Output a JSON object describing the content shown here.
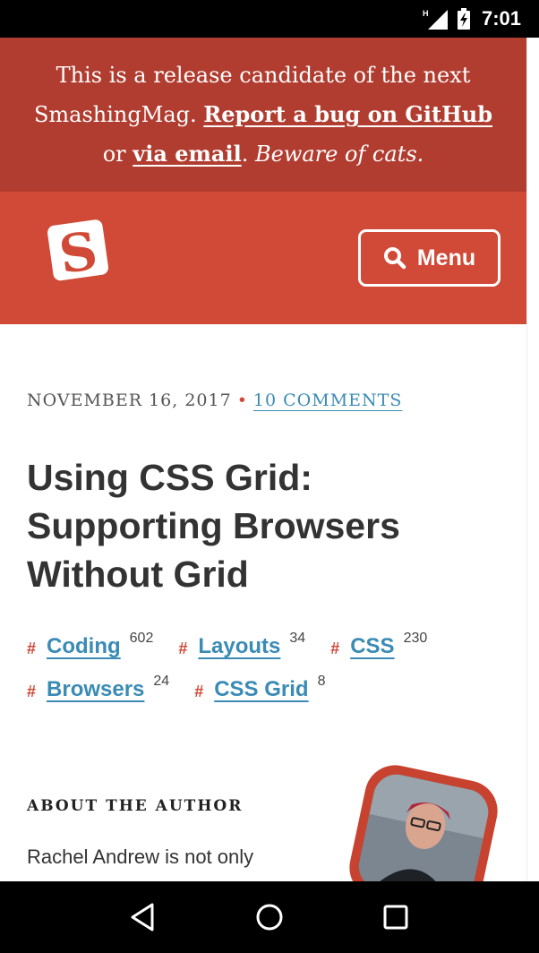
{
  "status_bar": {
    "time": "7:01",
    "network": "H",
    "icons": [
      "signal-icon",
      "battery-charging-icon"
    ]
  },
  "banner": {
    "line1": "This is a release candidate of the next",
    "line2_prefix": "SmashingMag. ",
    "bug_link": "Report a bug on GitHub",
    "line3_prefix": "or ",
    "email_link": "via email",
    "period": ". ",
    "cats_note": "Beware of cats."
  },
  "header": {
    "logo": "smashing-logo-icon",
    "menu_label": "Menu",
    "menu_icon": "search-icon"
  },
  "article": {
    "date": "November 16, 2017",
    "separator": "•",
    "comments": "10 comments",
    "title": "Using CSS Grid: Supporting Browsers Without Grid",
    "tag_hash": "#",
    "tags": [
      {
        "name": "Coding",
        "count": "602"
      },
      {
        "name": "Layouts",
        "count": "34"
      },
      {
        "name": "CSS",
        "count": "230"
      },
      {
        "name": "Browsers",
        "count": "24"
      },
      {
        "name": "CSS Grid",
        "count": "8"
      }
    ]
  },
  "author": {
    "heading": "About The Author",
    "text": "Rachel Andrew is not only"
  },
  "nav_bar": {
    "buttons": [
      "back-icon",
      "home-icon",
      "recents-icon"
    ]
  },
  "colors": {
    "banner": "#b13d30",
    "header": "#d04a37",
    "link": "#3a8bb5",
    "accent": "#d04a37"
  }
}
